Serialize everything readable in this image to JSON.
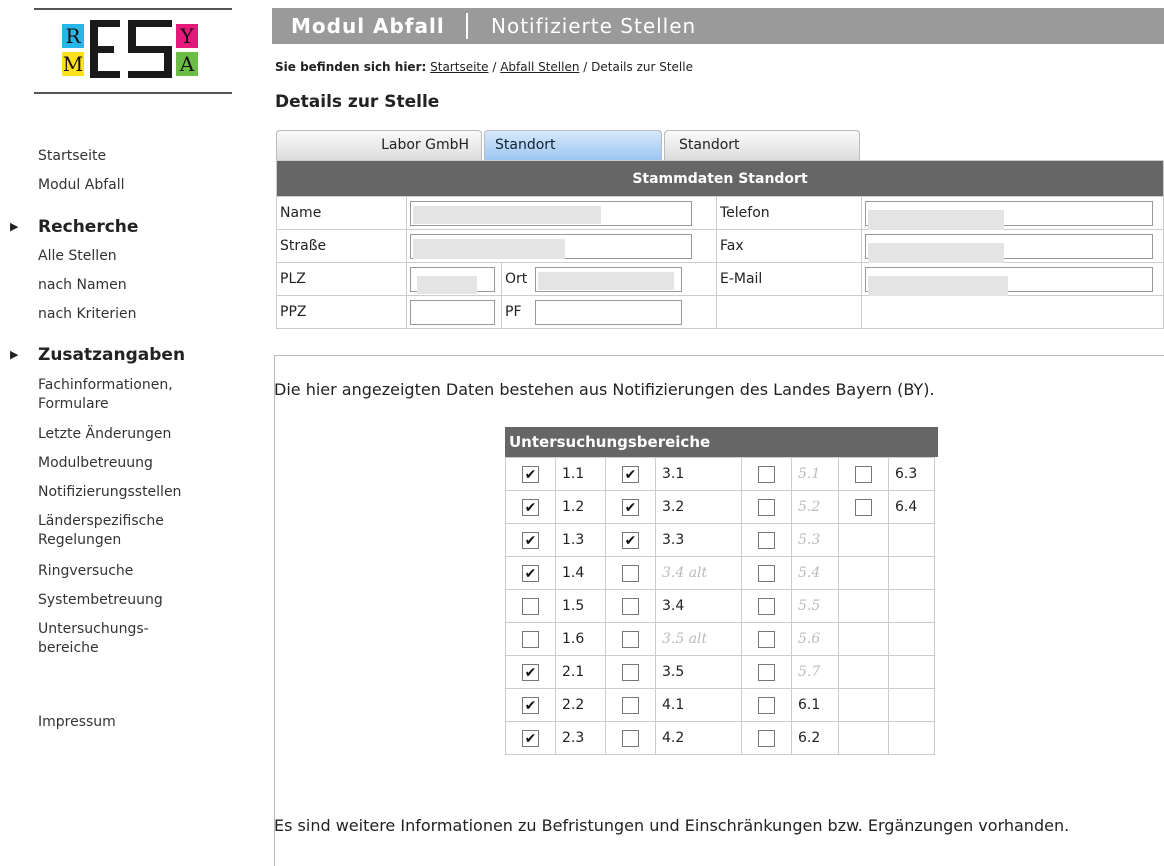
{
  "logo": {
    "letters": [
      "R",
      "Y",
      "M",
      "A"
    ]
  },
  "sidebar": {
    "top_items": [
      "Startseite",
      "Modul Abfall"
    ],
    "recherche_title": "Recherche",
    "recherche_items": [
      "Alle Stellen",
      "nach Namen",
      "nach Kriterien"
    ],
    "zusatz_title": "Zusatzangaben",
    "zusatz_items": [
      "Fachinformationen,",
      "Formulare",
      "Letzte Änderungen",
      "Modulbetreuung",
      "Notifizierungsstellen",
      "Länderspezifische",
      "Regelungen",
      "Ringversuche",
      "Systembetreuung",
      "Untersuchungs-",
      "bereiche"
    ],
    "impressum": "Impressum"
  },
  "header": {
    "module": "Modul Abfall",
    "section": "Notifizierte Stellen"
  },
  "breadcrumb": {
    "prefix": "Sie befinden sich hier:",
    "home": "Startseite",
    "sep": "/",
    "stellen": "Abfall Stellen",
    "current": "Details zur Stelle"
  },
  "page_title": "Details zur Stelle",
  "tabs": [
    "Labor GmbH",
    "Standort",
    "Standort"
  ],
  "stammdaten": {
    "title": "Stammdaten Standort",
    "name": "Name",
    "strasse": "Straße",
    "plz": "PLZ",
    "ort": "Ort",
    "ppz": "PPZ",
    "pf": "PF",
    "telefon": "Telefon",
    "fax": "Fax",
    "email": "E-Mail"
  },
  "info_text": "Die hier angezeigten Daten bestehen aus Notifizierungen des Landes Bayern (BY).",
  "untersuchungsbereiche": {
    "title": "Untersuchungsbereiche",
    "rows": [
      [
        {
          "label": "1.1",
          "checked": true
        },
        {
          "label": "3.1",
          "checked": true
        },
        {
          "label": "5.1",
          "checked": false,
          "disabled": true
        },
        {
          "label": "6.3",
          "checked": false
        }
      ],
      [
        {
          "label": "1.2",
          "checked": true
        },
        {
          "label": "3.2",
          "checked": true
        },
        {
          "label": "5.2",
          "checked": false,
          "disabled": true
        },
        {
          "label": "6.4",
          "checked": false
        }
      ],
      [
        {
          "label": "1.3",
          "checked": true
        },
        {
          "label": "3.3",
          "checked": true
        },
        {
          "label": "5.3",
          "checked": false,
          "disabled": true
        },
        null
      ],
      [
        {
          "label": "1.4",
          "checked": true
        },
        {
          "label": "3.4 alt",
          "checked": false,
          "disabled": true
        },
        {
          "label": "5.4",
          "checked": false,
          "disabled": true
        },
        null
      ],
      [
        {
          "label": "1.5",
          "checked": false
        },
        {
          "label": "3.4",
          "checked": false
        },
        {
          "label": "5.5",
          "checked": false,
          "disabled": true
        },
        null
      ],
      [
        {
          "label": "1.6",
          "checked": false
        },
        {
          "label": "3.5 alt",
          "checked": false,
          "disabled": true
        },
        {
          "label": "5.6",
          "checked": false,
          "disabled": true
        },
        null
      ],
      [
        {
          "label": "2.1",
          "checked": true
        },
        {
          "label": "3.5",
          "checked": false
        },
        {
          "label": "5.7",
          "checked": false,
          "disabled": true
        },
        null
      ],
      [
        {
          "label": "2.2",
          "checked": true
        },
        {
          "label": "4.1",
          "checked": false
        },
        {
          "label": "6.1",
          "checked": false
        },
        null
      ],
      [
        {
          "label": "2.3",
          "checked": true
        },
        {
          "label": "4.2",
          "checked": false
        },
        {
          "label": "6.2",
          "checked": false
        },
        null
      ]
    ]
  },
  "footer_text": "Es sind weitere Informationen zu Befristungen und Einschränkungen bzw. Ergänzungen vorhanden."
}
